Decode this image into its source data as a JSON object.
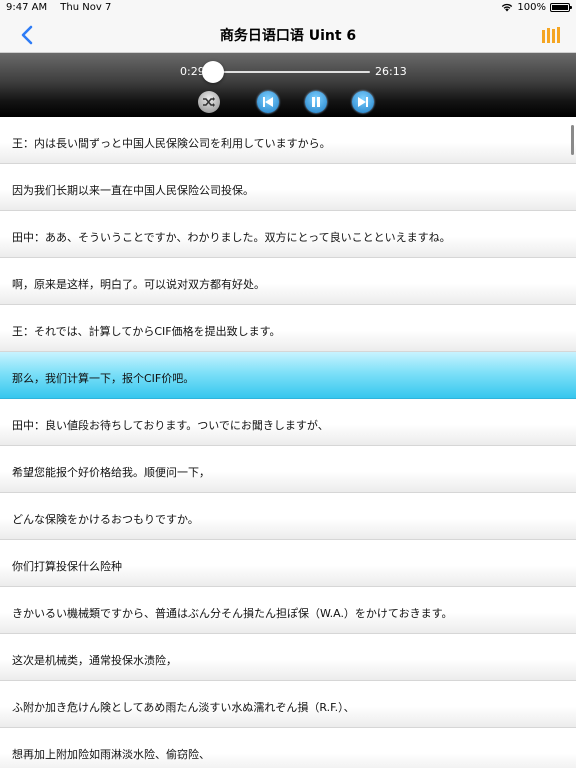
{
  "status_bar": {
    "time": "9:47 AM",
    "date": "Thu Nov 7",
    "battery": "100%",
    "battery_level": 1.0
  },
  "nav": {
    "title": "商务日语口语 Uint 6",
    "back_icon": "chevron-left-icon",
    "list_icon": "library-icon",
    "accent_color": "#2e7cf6",
    "list_icon_color": "#f5a623"
  },
  "player": {
    "current_time": "0:29",
    "total_time": "26:13",
    "progress": 0.0184,
    "controls": [
      "shuffle-icon",
      "previous-icon",
      "pause-icon",
      "next-icon"
    ]
  },
  "list": {
    "active_index": 5,
    "rows": [
      "王：内は長い間ずっと中国人民保険公司を利用していますから。",
      "因为我们长期以来一直在中国人民保险公司投保。",
      "田中：ああ、そういうことですか、わかりました。双方にとって良いことといえますね。",
      "啊，原来是这样，明白了。可以说对双方都有好处。",
      "王：それでは、計算してからCIF価格を提出致します。",
      "那么，我们计算一下，报个CIF价吧。",
      "田中：良い値段お待ちしております。ついでにお聞きしますが、",
      "希望您能报个好价格给我。顺便问一下，",
      "どんな保険をかけるおつもりですか。",
      "你们打算投保什么险种",
      "きかいるい機械類ですから、普通はぶん分そん損たん担ぽ保（W.A.）をかけておきます。",
      "这次是机械类，通常投保水渍险，",
      "ふ附か加き危けん険としてあめ雨たん淡すい水ぬ濡れぞん損（R.F.）、",
      "想再加上附加险如雨淋淡水险、偷窃险、"
    ]
  }
}
